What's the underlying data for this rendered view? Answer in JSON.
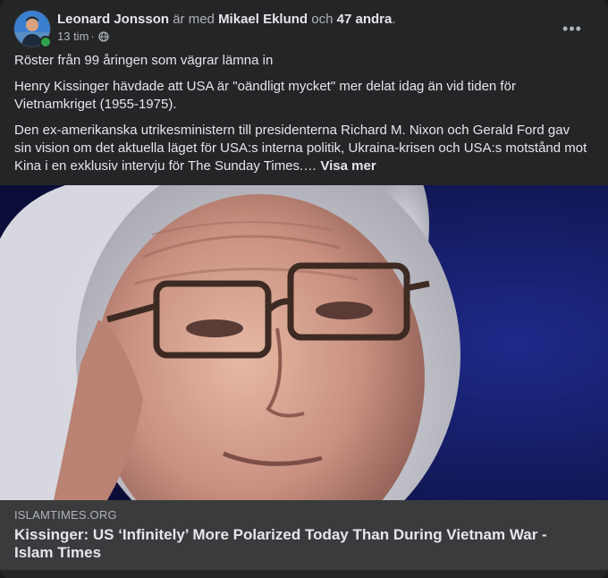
{
  "post": {
    "author": "Leonard Jonsson",
    "with_text": "är med",
    "tagged": "Mikael Eklund",
    "and_text": "och",
    "others": "47 andra",
    "period": ".",
    "time": "13 tim",
    "separator": "·",
    "privacy_icon": "globe-icon",
    "more_icon": "more-horizontal-icon",
    "more_glyph": "•••"
  },
  "body": {
    "line1": "Röster från 99 åringen som vägrar lämna in",
    "line2": "Henry Kissinger hävdade att USA är \"oändligt mycket\" mer delat idag än vid tiden för Vietnamkriget (1955-1975).",
    "line3": "Den ex-amerikanska utrikesministern till presidenterna Richard M. Nixon och Gerald Ford gav sin vision om det aktuella läget för USA:s interna politik, Ukraina-krisen och USA:s motstånd mot Kina i en exklusiv intervju för The Sunday Times.…",
    "see_more": "Visa mer"
  },
  "link": {
    "domain": "ISLAMTIMES.ORG",
    "title": "Kissinger: US ‘Infinitely’ More Polarized Today Than During Vietnam War - Islam Times"
  },
  "colors": {
    "card_bg": "#242526",
    "link_bg": "#3a3b3c",
    "online": "#31a24c"
  }
}
